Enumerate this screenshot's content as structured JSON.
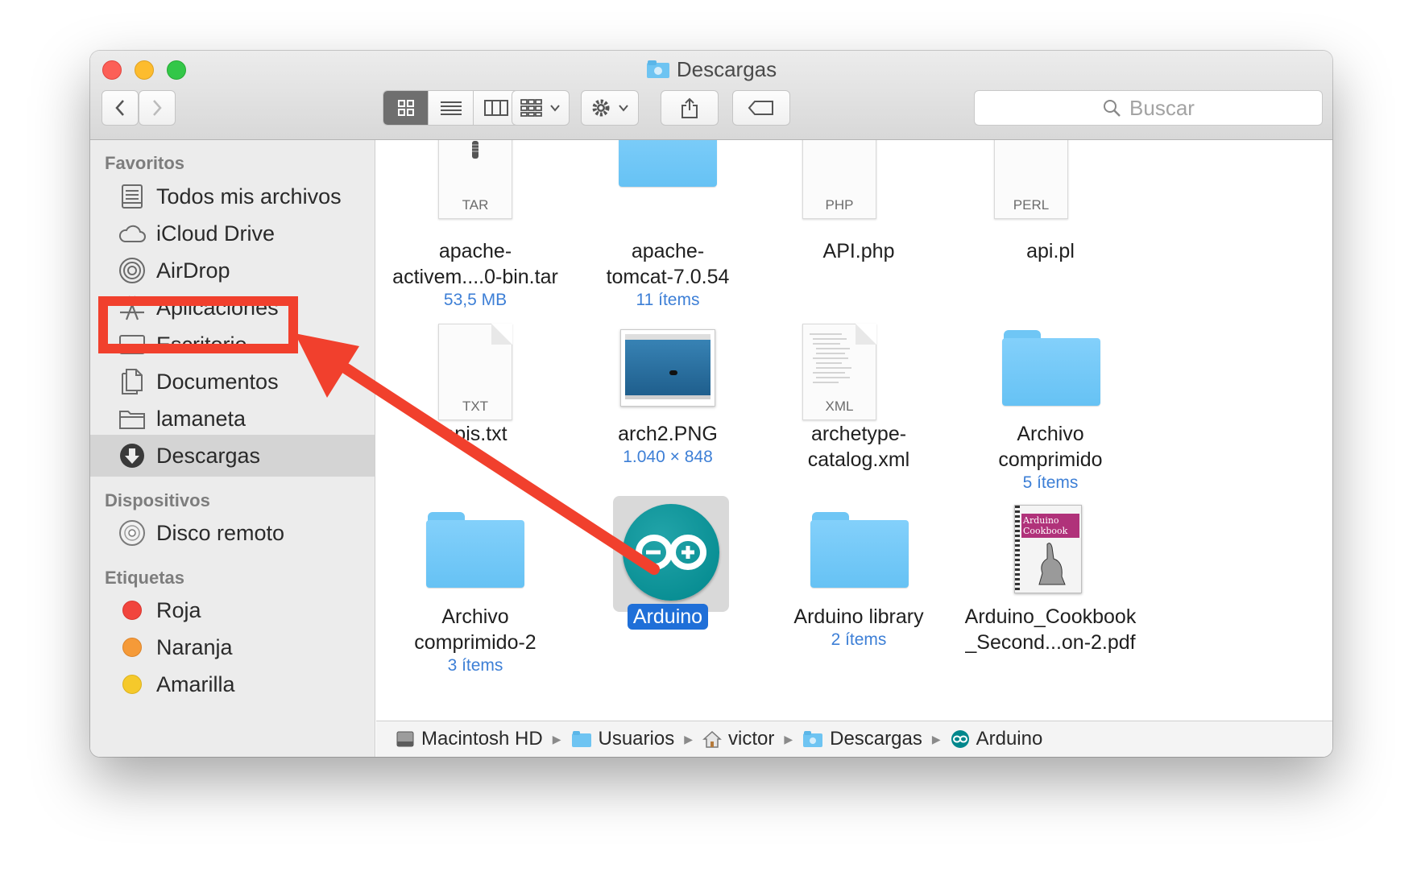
{
  "window": {
    "title": "Descargas"
  },
  "toolbar": {
    "back_icon": "chevron-left-icon",
    "forward_icon": "chevron-right-icon",
    "view_modes": [
      "icon-view-icon",
      "list-view-icon",
      "column-view-icon",
      "coverflow-view-icon"
    ],
    "search_placeholder": "Buscar"
  },
  "sidebar": {
    "sections": {
      "favorites": "Favoritos",
      "devices": "Dispositivos",
      "tags": "Etiquetas"
    },
    "favorites": [
      {
        "label": "Todos mis archivos",
        "icon": "all-files-icon"
      },
      {
        "label": "iCloud Drive",
        "icon": "cloud-icon"
      },
      {
        "label": "AirDrop",
        "icon": "airdrop-icon"
      },
      {
        "label": "Aplicaciones",
        "icon": "applications-icon"
      },
      {
        "label": "Escritorio",
        "icon": "desktop-icon"
      },
      {
        "label": "Documentos",
        "icon": "documents-icon"
      },
      {
        "label": "lamaneta",
        "icon": "folder-icon"
      },
      {
        "label": "Descargas",
        "icon": "downloads-icon",
        "selected": true
      }
    ],
    "devices": [
      {
        "label": "Disco remoto",
        "icon": "disc-icon"
      }
    ],
    "tags": [
      {
        "label": "Roja",
        "color": "#f1453d"
      },
      {
        "label": "Naranja",
        "color": "#f59a38"
      },
      {
        "label": "Amarilla",
        "color": "#f5c92b"
      }
    ]
  },
  "files": [
    {
      "name": "apache-\nactivem....0-bin.tar",
      "sub": "53,5 MB",
      "kind": "doc",
      "ext": "TAR"
    },
    {
      "name": "apache-\ntomcat-7.0.54",
      "sub": "11 ítems",
      "kind": "folder"
    },
    {
      "name": "API.php",
      "sub": "",
      "kind": "doc",
      "ext": "PHP"
    },
    {
      "name": "api.pl",
      "sub": "",
      "kind": "doc",
      "ext": "PERL"
    },
    {
      "name": "apis.txt",
      "sub": "",
      "kind": "doc",
      "ext": "TXT"
    },
    {
      "name": "arch2.PNG",
      "sub": "1.040 × 848",
      "kind": "image"
    },
    {
      "name": "archetype-\ncatalog.xml",
      "sub": "",
      "kind": "doc",
      "ext": "XML"
    },
    {
      "name": "Archivo\ncomprimido",
      "sub": "5 ítems",
      "kind": "folder"
    },
    {
      "name": "Archivo\ncomprimido-2",
      "sub": "3 ítems",
      "kind": "folder"
    },
    {
      "name": "Arduino",
      "sub": "",
      "kind": "app",
      "selected": true
    },
    {
      "name": "Arduino library",
      "sub": "2 ítems",
      "kind": "folder"
    },
    {
      "name": "Arduino_Cookbook\n_Second...on-2.pdf",
      "sub": "",
      "kind": "pdf",
      "cover_title": "Arduino\nCookbook"
    }
  ],
  "pathbar": [
    {
      "label": "Macintosh HD",
      "icon": "hard-drive-icon"
    },
    {
      "label": "Usuarios",
      "icon": "folder-icon"
    },
    {
      "label": "victor",
      "icon": "home-icon"
    },
    {
      "label": "Descargas",
      "icon": "downloads-folder-icon"
    },
    {
      "label": "Arduino",
      "icon": "arduino-icon"
    }
  ],
  "annotation": {
    "color": "#f1402d"
  }
}
